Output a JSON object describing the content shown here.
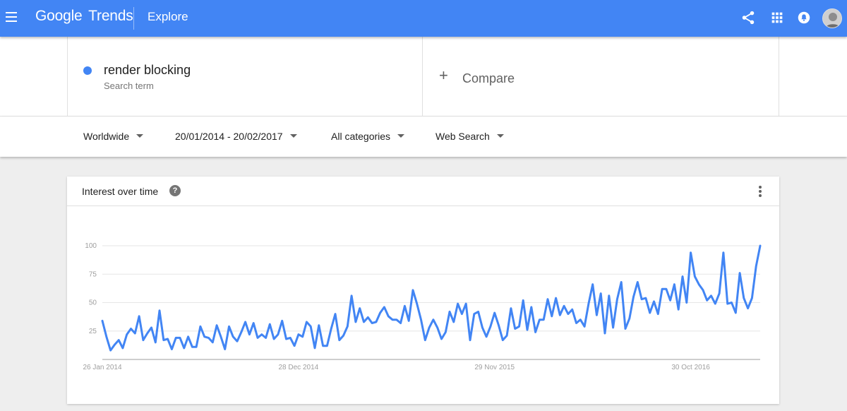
{
  "header": {
    "brand_google": "Google",
    "brand_trends": "Trends",
    "page_title": "Explore",
    "icons": [
      "menu-icon",
      "share-icon",
      "apps-icon",
      "notifications-icon",
      "avatar"
    ]
  },
  "search_term": {
    "name": "render blocking",
    "subtitle": "Search term",
    "color": "#4285f4"
  },
  "compare": {
    "label": "Compare"
  },
  "filters": {
    "region": "Worldwide",
    "date_range": "20/01/2014 - 20/02/2017",
    "category": "All categories",
    "search_type": "Web Search"
  },
  "card": {
    "title": "Interest over time"
  },
  "chart_data": {
    "type": "line",
    "ylim": [
      0,
      100
    ],
    "yticks": [
      25,
      50,
      75,
      100
    ],
    "xticks": [
      {
        "index": 0,
        "label": "26 Jan 2014"
      },
      {
        "index": 48,
        "label": "28 Dec 2014"
      },
      {
        "index": 96,
        "label": "29 Nov 2015"
      },
      {
        "index": 144,
        "label": "30 Oct 2016"
      }
    ],
    "series": [
      {
        "color": "#4285f4",
        "values": [
          34,
          20,
          8,
          13,
          17,
          10,
          22,
          27,
          23,
          38,
          17,
          23,
          28,
          15,
          43,
          17,
          18,
          9,
          19,
          19,
          10,
          20,
          11,
          11,
          29,
          20,
          19,
          15,
          30,
          20,
          9,
          29,
          20,
          16,
          24,
          33,
          22,
          32,
          19,
          22,
          19,
          31,
          18,
          22,
          34,
          18,
          19,
          12,
          22,
          20,
          33,
          29,
          10,
          30,
          12,
          12,
          27,
          40,
          17,
          21,
          29,
          56,
          33,
          45,
          33,
          37,
          32,
          33,
          41,
          46,
          38,
          35,
          35,
          32,
          47,
          34,
          61,
          49,
          35,
          17,
          28,
          35,
          28,
          18,
          24,
          42,
          33,
          49,
          40,
          49,
          17,
          40,
          42,
          28,
          20,
          29,
          41,
          30,
          17,
          21,
          45,
          27,
          29,
          52,
          26,
          46,
          24,
          35,
          35,
          53,
          38,
          54,
          39,
          47,
          40,
          44,
          32,
          35,
          29,
          49,
          66,
          39,
          58,
          23,
          56,
          28,
          53,
          68,
          27,
          36,
          55,
          68,
          53,
          54,
          41,
          51,
          40,
          62,
          62,
          52,
          66,
          44,
          73,
          50,
          94,
          73,
          66,
          61,
          52,
          56,
          49,
          58,
          94,
          49,
          50,
          41,
          76,
          54,
          45,
          54,
          82,
          100
        ]
      }
    ]
  }
}
